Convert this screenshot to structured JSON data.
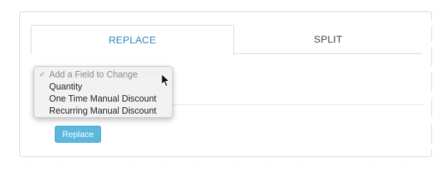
{
  "tabs": [
    {
      "label": "REPLACE",
      "active": true
    },
    {
      "label": "SPLIT",
      "active": false
    }
  ],
  "field_select": {
    "selected": "Add a Field to Change",
    "options": [
      "Add a Field to Change",
      "Quantity",
      "One Time Manual Discount",
      "Recurring Manual Discount"
    ],
    "check_glyph": "✓"
  },
  "replace_button": {
    "label": "Replace"
  },
  "colors": {
    "accent": "#2b88b5",
    "button": "#5bb8dc",
    "border": "#d7d7d7"
  },
  "icons": {
    "cursor": "mouse-pointer-icon",
    "check": "checkmark-icon"
  }
}
